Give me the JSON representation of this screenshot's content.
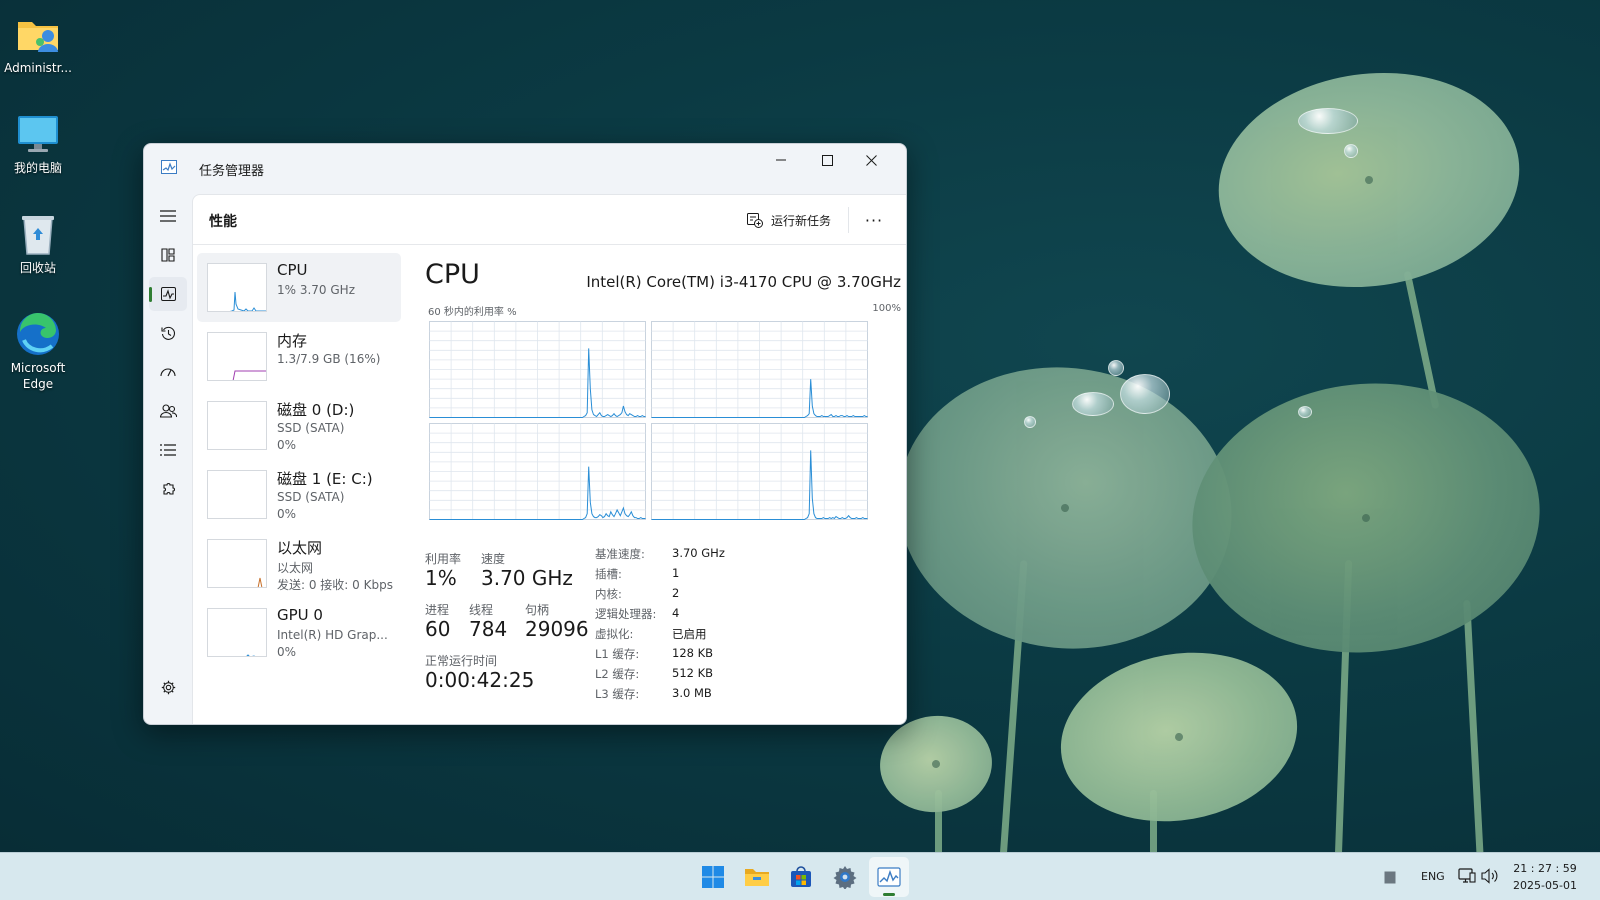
{
  "desktop": {
    "icons": [
      {
        "label": "Administr..."
      },
      {
        "label": "我的电脑"
      },
      {
        "label": "回收站"
      },
      {
        "label": "Microsoft Edge"
      }
    ]
  },
  "window": {
    "title": "任务管理器",
    "page_title": "性能",
    "run_new_task": "运行新任务",
    "more": "···"
  },
  "devices": [
    {
      "name": "CPU",
      "line1": "1%  3.70 GHz",
      "line2": ""
    },
    {
      "name": "内存",
      "line1": "1.3/7.9 GB (16%)",
      "line2": ""
    },
    {
      "name": "磁盘 0 (D:)",
      "line1": "SSD (SATA)",
      "line2": "0%"
    },
    {
      "name": "磁盘 1 (E: C:)",
      "line1": "SSD (SATA)",
      "line2": "0%"
    },
    {
      "name": "以太网",
      "line1": "以太网",
      "line2": "发送: 0 接收: 0 Kbps"
    },
    {
      "name": "GPU 0",
      "line1": "Intel(R) HD Grap...",
      "line2": "0%"
    }
  ],
  "cpu": {
    "heading": "CPU",
    "model": "Intel(R) Core(TM) i3-4170 CPU @ 3.70GHz",
    "graph_label": "60 秒内的利用率 %",
    "graph_max": "100%",
    "core_usage": [
      [
        0,
        0,
        0,
        0,
        0,
        0,
        0,
        0,
        0,
        0,
        0,
        0,
        0,
        0,
        0,
        0,
        0,
        0,
        0,
        0,
        0,
        0,
        0,
        0,
        0,
        0,
        0,
        0,
        0,
        0,
        0,
        0,
        0,
        0,
        0,
        0,
        0,
        0,
        0,
        0,
        0,
        0,
        0,
        0,
        0,
        0,
        0,
        0,
        0,
        0,
        0,
        0,
        0,
        0,
        0,
        0,
        0,
        0,
        0,
        0,
        0,
        0,
        0,
        0,
        0,
        0,
        0,
        0,
        0,
        0,
        0,
        0,
        0,
        0,
        0,
        0,
        0,
        0,
        0,
        0,
        0,
        0,
        0,
        0,
        0,
        0,
        0,
        0,
        0,
        0,
        0,
        0,
        0,
        0,
        0,
        0,
        0,
        0,
        1,
        2,
        5,
        72,
        30,
        8,
        3,
        2,
        1,
        3,
        5,
        2,
        1,
        1,
        2,
        3,
        2,
        1,
        2,
        4,
        2,
        1,
        2,
        3,
        5,
        12,
        6,
        3,
        2,
        4,
        3,
        2,
        1,
        1,
        2,
        1,
        1,
        2,
        1,
        1
      ],
      [
        0,
        0,
        0,
        0,
        0,
        0,
        0,
        0,
        0,
        0,
        0,
        0,
        0,
        0,
        0,
        0,
        0,
        0,
        0,
        0,
        0,
        0,
        0,
        0,
        0,
        0,
        0,
        0,
        0,
        0,
        0,
        0,
        0,
        0,
        0,
        0,
        0,
        0,
        0,
        0,
        0,
        0,
        0,
        0,
        0,
        0,
        0,
        0,
        0,
        0,
        0,
        0,
        0,
        0,
        0,
        0,
        0,
        0,
        0,
        0,
        0,
        0,
        0,
        0,
        0,
        0,
        0,
        0,
        0,
        0,
        0,
        0,
        0,
        0,
        0,
        0,
        0,
        0,
        0,
        0,
        0,
        0,
        0,
        0,
        0,
        0,
        0,
        0,
        0,
        0,
        0,
        0,
        0,
        0,
        0,
        0,
        0,
        0,
        1,
        2,
        4,
        40,
        12,
        4,
        2,
        1,
        1,
        1,
        2,
        1,
        1,
        1,
        1,
        2,
        3,
        1,
        1,
        2,
        1,
        1,
        2,
        2,
        1,
        1,
        2,
        1,
        1,
        1,
        2,
        1,
        1,
        1,
        1,
        1,
        1,
        2,
        1,
        1
      ],
      [
        0,
        0,
        0,
        0,
        0,
        0,
        0,
        0,
        0,
        0,
        0,
        0,
        0,
        0,
        0,
        0,
        0,
        0,
        0,
        0,
        0,
        0,
        0,
        0,
        0,
        0,
        0,
        0,
        0,
        0,
        0,
        0,
        0,
        0,
        0,
        0,
        0,
        0,
        0,
        0,
        0,
        0,
        0,
        0,
        0,
        0,
        0,
        0,
        0,
        0,
        0,
        0,
        0,
        0,
        0,
        0,
        0,
        0,
        0,
        0,
        0,
        0,
        0,
        0,
        0,
        0,
        0,
        0,
        0,
        0,
        0,
        0,
        0,
        0,
        0,
        0,
        0,
        0,
        0,
        0,
        0,
        0,
        0,
        0,
        0,
        0,
        0,
        0,
        0,
        0,
        0,
        0,
        0,
        0,
        0,
        0,
        0,
        0,
        1,
        2,
        6,
        55,
        18,
        6,
        3,
        2,
        2,
        3,
        5,
        4,
        2,
        3,
        6,
        4,
        3,
        8,
        5,
        3,
        6,
        10,
        7,
        4,
        8,
        12,
        6,
        4,
        3,
        5,
        8,
        4,
        2,
        2,
        1,
        1,
        2,
        1,
        1,
        1
      ],
      [
        0,
        0,
        0,
        0,
        0,
        0,
        0,
        0,
        0,
        0,
        0,
        0,
        0,
        0,
        0,
        0,
        0,
        0,
        0,
        0,
        0,
        0,
        0,
        0,
        0,
        0,
        0,
        0,
        0,
        0,
        0,
        0,
        0,
        0,
        0,
        0,
        0,
        0,
        0,
        0,
        0,
        0,
        0,
        0,
        0,
        0,
        0,
        0,
        0,
        0,
        0,
        0,
        0,
        0,
        0,
        0,
        0,
        0,
        0,
        0,
        0,
        0,
        0,
        0,
        0,
        0,
        0,
        0,
        0,
        0,
        0,
        0,
        0,
        0,
        0,
        0,
        0,
        0,
        0,
        0,
        0,
        0,
        0,
        0,
        0,
        0,
        0,
        0,
        0,
        0,
        0,
        0,
        0,
        0,
        0,
        0,
        0,
        0,
        1,
        2,
        6,
        72,
        22,
        6,
        2,
        1,
        1,
        1,
        1,
        2,
        1,
        1,
        1,
        2,
        1,
        2,
        1,
        3,
        2,
        1,
        1,
        2,
        1,
        1,
        2,
        4,
        2,
        1,
        1,
        1,
        2,
        1,
        1,
        1,
        2,
        1,
        1,
        1
      ]
    ],
    "stats": {
      "util_label": "利用率",
      "util": "1%",
      "speed_label": "速度",
      "speed": "3.70 GHz",
      "proc_label": "进程",
      "proc": "60",
      "thread_label": "线程",
      "thread": "784",
      "handle_label": "句柄",
      "handle": "29096",
      "uptime_label": "正常运行时间",
      "uptime": "0:00:42:25"
    },
    "specs": [
      {
        "k": "基准速度:",
        "v": "3.70 GHz"
      },
      {
        "k": "插槽:",
        "v": "1"
      },
      {
        "k": "内核:",
        "v": "2"
      },
      {
        "k": "逻辑处理器:",
        "v": "4"
      },
      {
        "k": "虚拟化:",
        "v": "已启用"
      },
      {
        "k": "L1 缓存:",
        "v": "128 KB"
      },
      {
        "k": "L2 缓存:",
        "v": "512 KB"
      },
      {
        "k": "L3 缓存:",
        "v": "3.0 MB"
      }
    ]
  },
  "taskbar": {
    "lang": "ENG",
    "time": "21 : 27 : 59",
    "date": "2025-05-01"
  },
  "colors": {
    "accent_green": "#2f7d32",
    "graph_line": "#2a8ed6",
    "graph_grid": "#dfe6ee",
    "memory_line": "#a13fb0",
    "ethernet_line": "#c7702a"
  }
}
